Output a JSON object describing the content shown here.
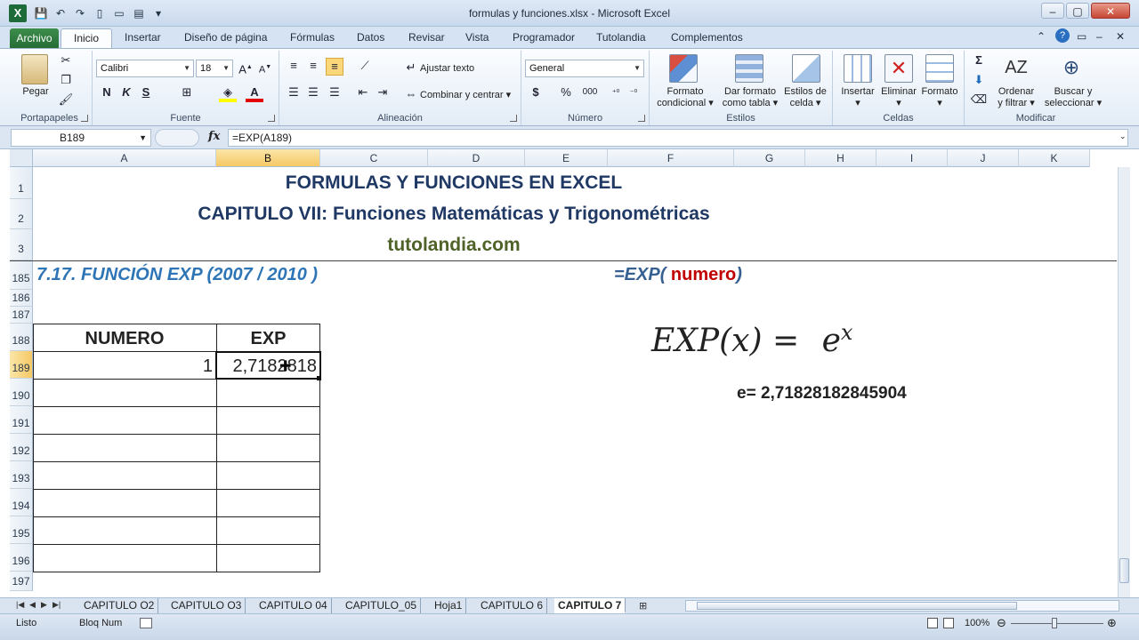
{
  "window": {
    "title": "formulas y funciones.xlsx - Microsoft Excel",
    "logo": "X"
  },
  "ribbon_tabs": {
    "file": "Archivo",
    "active": "Inicio",
    "items": [
      "Insertar",
      "Diseño de página",
      "Fórmulas",
      "Datos",
      "Revisar",
      "Vista",
      "Programador",
      "Tutolandia",
      "Complementos"
    ]
  },
  "ribbon": {
    "clipboard": {
      "label": "Portapapeles",
      "paste": "Pegar"
    },
    "font": {
      "label": "Fuente",
      "family": "Calibri",
      "size": "18",
      "bold": "N",
      "italic": "K",
      "underline": "S"
    },
    "alignment": {
      "label": "Alineación",
      "wrap_text": "Ajustar texto",
      "merge_center": "Combinar y centrar"
    },
    "number": {
      "label": "Número",
      "format": "General",
      "currency": "$",
      "percent": "%",
      "thousands": "000"
    },
    "styles": {
      "label": "Estilos",
      "cond_format_1": "Formato",
      "cond_format_2": "condicional",
      "table_format_1": "Dar formato",
      "table_format_2": "como tabla",
      "cell_styles_1": "Estilos de",
      "cell_styles_2": "celda"
    },
    "cells": {
      "label": "Celdas",
      "insert": "Insertar",
      "delete": "Eliminar",
      "format": "Formato"
    },
    "editing": {
      "label": "Modificar",
      "sort_1": "Ordenar",
      "sort_2": "y filtrar",
      "find_1": "Buscar y",
      "find_2": "seleccionar"
    }
  },
  "formula_bar": {
    "name_box": "B189",
    "fx": "fx",
    "formula": "=EXP(A189)"
  },
  "columns": [
    "A",
    "B",
    "C",
    "D",
    "E",
    "F",
    "G",
    "H",
    "I",
    "J",
    "K"
  ],
  "rows": [
    "1",
    "2",
    "3",
    "185",
    "186",
    "187",
    "188",
    "189",
    "190",
    "191",
    "192",
    "193",
    "194",
    "195",
    "196",
    "197"
  ],
  "sheet": {
    "title1": "FORMULAS Y FUNCIONES EN EXCEL",
    "title2": "CAPITULO VII: Funciones Matemáticas y Trigonométricas",
    "site": "tutolandia.com",
    "section": "7.17. FUNCIÓN EXP (2007 / 2010 )",
    "syntax_prefix": "=EXP(",
    "syntax_arg": " numero",
    "syntax_suffix": ")",
    "table_header_a": "NUMERO",
    "table_header_b": "EXP",
    "cell_a189": "1",
    "cell_b189": "2,7182818",
    "formula_lhs": "EXP(x) = ",
    "formula_base": "e",
    "formula_exp": "x",
    "e_value": "e= 2,71828182845904"
  },
  "sheet_tabs": [
    "CAPITULO O2",
    "CAPITULO O3",
    "CAPITULO 04",
    "CAPITULO_05",
    "Hoja1",
    "CAPITULO 6",
    "CAPITULO 7"
  ],
  "status_bar": {
    "ready": "Listo",
    "numlock": "Bloq Num",
    "zoom": "100%"
  },
  "colors": {
    "title_blue": "#1f3864",
    "site_green": "#4f6228",
    "section_blue": "#2e75b6",
    "syntax_green": "#376092",
    "syntax_red": "#c00000"
  }
}
